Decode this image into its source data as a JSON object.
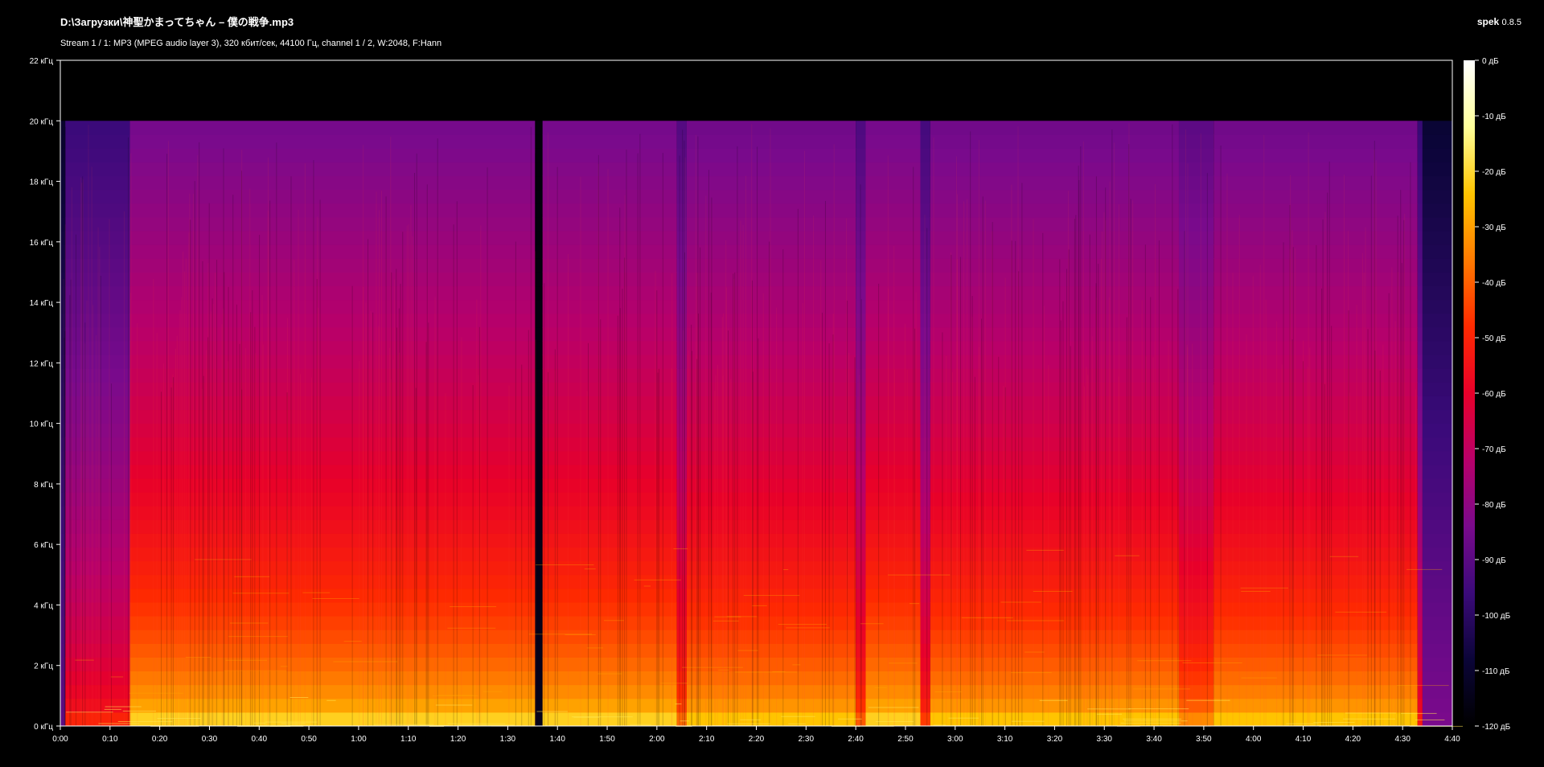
{
  "header": {
    "title": "D:\\Загрузки\\神聖かまってちゃん – 僕の戦争.mp3",
    "stream_info": "Stream 1 / 1: MP3 (MPEG audio layer 3), 320 кбит/сек, 44100 Гц, channel 1 / 2, W:2048, F:Hann",
    "app_name": "spek",
    "app_version": "0.8.5"
  },
  "colors": {
    "background": "#000000",
    "frame": "#ffffff",
    "palette": [
      "#000000",
      "#0b0538",
      "#3b0a7a",
      "#7a0a8c",
      "#b8006a",
      "#e8002a",
      "#ff2a00",
      "#ff7a00",
      "#ffc400",
      "#ffff9a",
      "#ffffff"
    ]
  },
  "chart_data": {
    "type": "heatmap",
    "title": "D:\\Загрузки\\神聖かまってちゃん – 僕の戦争.mp3",
    "xlabel": "",
    "ylabel": "",
    "x_unit": "time (m:ss)",
    "y_unit": "кГц",
    "xlim": [
      0,
      280
    ],
    "ylim": [
      0,
      22
    ],
    "x_ticks": [
      {
        "value": 0,
        "label": "0:00"
      },
      {
        "value": 10,
        "label": "0:10"
      },
      {
        "value": 20,
        "label": "0:20"
      },
      {
        "value": 30,
        "label": "0:30"
      },
      {
        "value": 40,
        "label": "0:40"
      },
      {
        "value": 50,
        "label": "0:50"
      },
      {
        "value": 60,
        "label": "1:00"
      },
      {
        "value": 70,
        "label": "1:10"
      },
      {
        "value": 80,
        "label": "1:20"
      },
      {
        "value": 90,
        "label": "1:30"
      },
      {
        "value": 100,
        "label": "1:40"
      },
      {
        "value": 110,
        "label": "1:50"
      },
      {
        "value": 120,
        "label": "2:00"
      },
      {
        "value": 130,
        "label": "2:10"
      },
      {
        "value": 140,
        "label": "2:20"
      },
      {
        "value": 150,
        "label": "2:30"
      },
      {
        "value": 160,
        "label": "2:40"
      },
      {
        "value": 170,
        "label": "2:50"
      },
      {
        "value": 180,
        "label": "3:00"
      },
      {
        "value": 190,
        "label": "3:10"
      },
      {
        "value": 200,
        "label": "3:20"
      },
      {
        "value": 210,
        "label": "3:30"
      },
      {
        "value": 220,
        "label": "3:40"
      },
      {
        "value": 230,
        "label": "3:50"
      },
      {
        "value": 240,
        "label": "4:00"
      },
      {
        "value": 250,
        "label": "4:10"
      },
      {
        "value": 260,
        "label": "4:20"
      },
      {
        "value": 270,
        "label": "4:30"
      },
      {
        "value": 280,
        "label": "4:40"
      }
    ],
    "y_ticks": [
      {
        "value": 0,
        "label": "0 кГц"
      },
      {
        "value": 2,
        "label": "2 кГц"
      },
      {
        "value": 4,
        "label": "4 кГц"
      },
      {
        "value": 6,
        "label": "6 кГц"
      },
      {
        "value": 8,
        "label": "8 кГц"
      },
      {
        "value": 10,
        "label": "10 кГц"
      },
      {
        "value": 12,
        "label": "12 кГц"
      },
      {
        "value": 14,
        "label": "14 кГц"
      },
      {
        "value": 16,
        "label": "16 кГц"
      },
      {
        "value": 18,
        "label": "18 кГц"
      },
      {
        "value": 20,
        "label": "20 кГц"
      },
      {
        "value": 22,
        "label": "22 кГц"
      }
    ],
    "colorbar": {
      "range": [
        -120,
        0
      ],
      "ticks": [
        {
          "value": 0,
          "label": "0 дБ"
        },
        {
          "value": -10,
          "label": "-10 дБ"
        },
        {
          "value": -20,
          "label": "-20 дБ"
        },
        {
          "value": -30,
          "label": "-30 дБ"
        },
        {
          "value": -40,
          "label": "-40 дБ"
        },
        {
          "value": -50,
          "label": "-50 дБ"
        },
        {
          "value": -60,
          "label": "-60 дБ"
        },
        {
          "value": -70,
          "label": "-70 дБ"
        },
        {
          "value": -80,
          "label": "-80 дБ"
        },
        {
          "value": -90,
          "label": "-90 дБ"
        },
        {
          "value": -100,
          "label": "-100 дБ"
        },
        {
          "value": -110,
          "label": "-110 дБ"
        },
        {
          "value": -120,
          "label": "-120 дБ"
        }
      ]
    },
    "spectral_cutoff_khz": 20,
    "audio_end_sec": 274,
    "segments": [
      {
        "start": 0,
        "end": 1,
        "level": 0.25
      },
      {
        "start": 1,
        "end": 14,
        "level": 0.62
      },
      {
        "start": 14,
        "end": 95.5,
        "level": 0.86
      },
      {
        "start": 95.5,
        "end": 97,
        "level": 0.05
      },
      {
        "start": 97,
        "end": 124,
        "level": 0.86
      },
      {
        "start": 124,
        "end": 126,
        "level": 0.72
      },
      {
        "start": 126,
        "end": 160,
        "level": 0.84
      },
      {
        "start": 160,
        "end": 162,
        "level": 0.7
      },
      {
        "start": 162,
        "end": 173,
        "level": 0.86
      },
      {
        "start": 173,
        "end": 175,
        "level": 0.66
      },
      {
        "start": 175,
        "end": 225,
        "level": 0.84
      },
      {
        "start": 225,
        "end": 232,
        "level": 0.76
      },
      {
        "start": 232,
        "end": 273,
        "level": 0.84
      },
      {
        "start": 273,
        "end": 274,
        "level": 0.6
      },
      {
        "start": 274,
        "end": 280,
        "level": 0.3
      }
    ]
  }
}
